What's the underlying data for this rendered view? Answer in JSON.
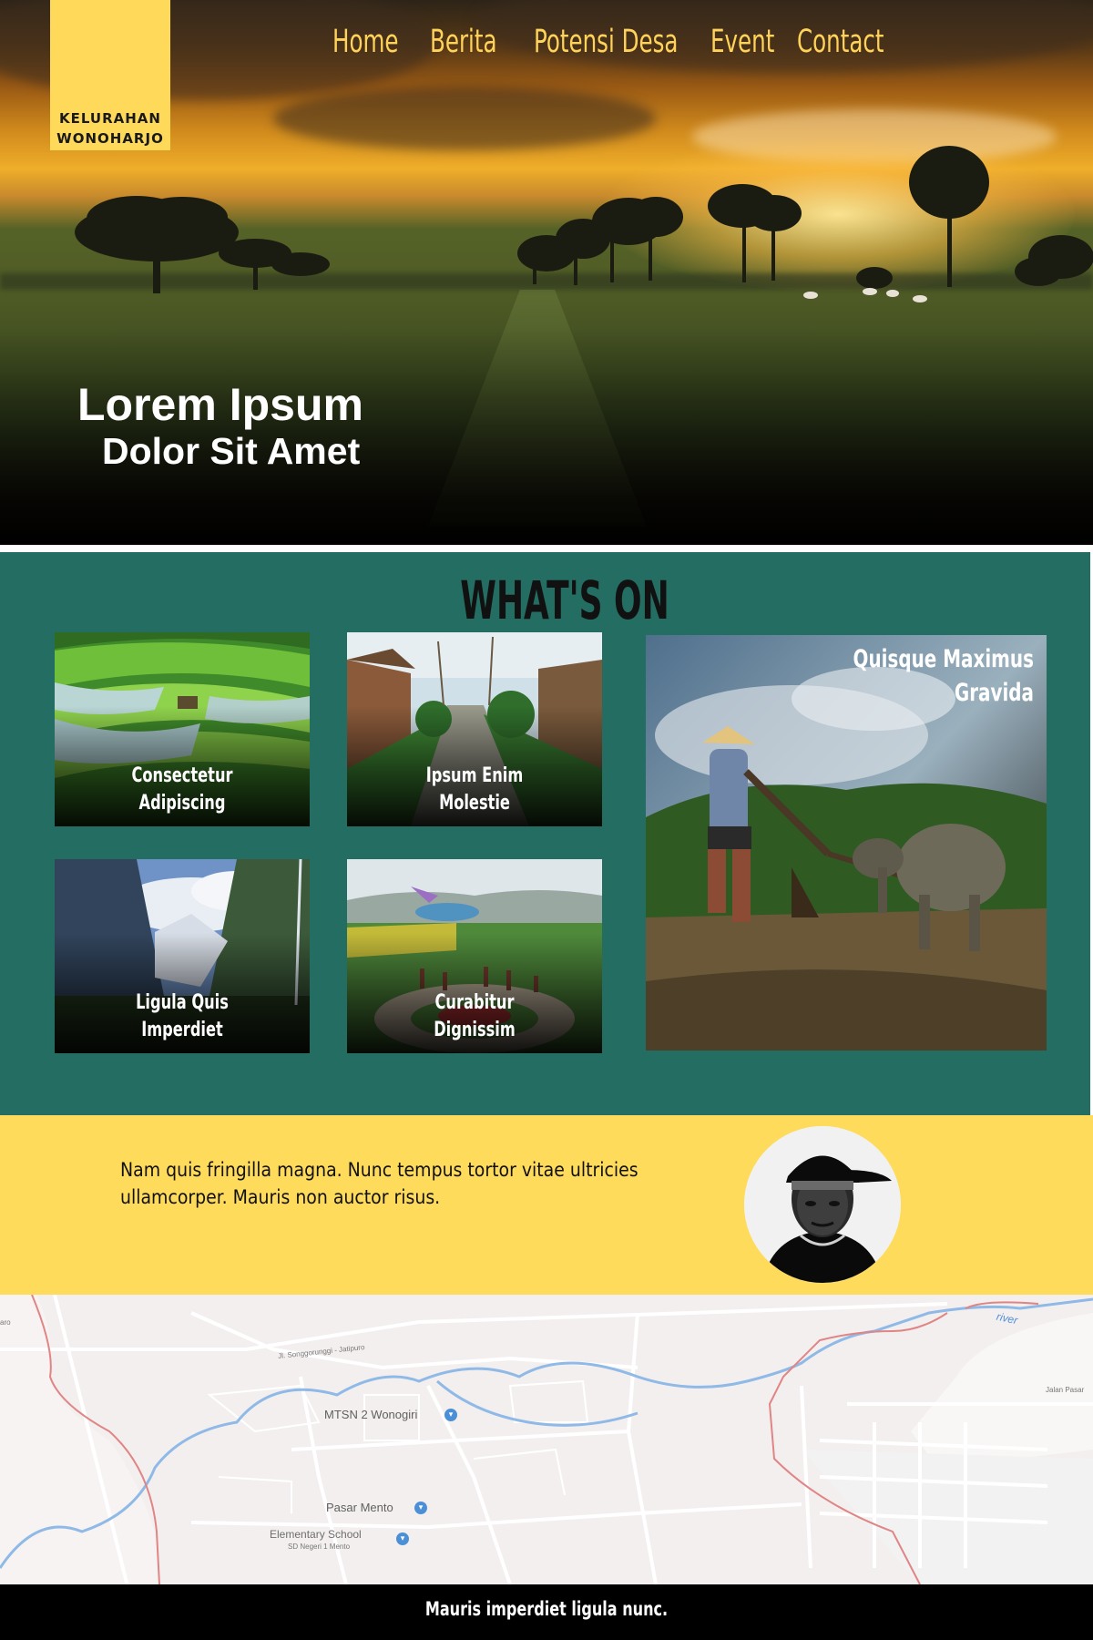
{
  "brand": {
    "line1": "KELURAHAN",
    "line2": "WONOHARJO",
    "color": "#ffd95a"
  },
  "nav": {
    "items": [
      "Home",
      "Berita",
      "Potensi Desa",
      "Event",
      "Contact"
    ],
    "color": "#ffd35a"
  },
  "hero": {
    "title": "Lorem Ipsum",
    "subtitle": "Dolor Sit Amet"
  },
  "whats_on": {
    "heading": "WHAT'S ON",
    "background": "#246d62",
    "cards": [
      {
        "line1": "Consectetur",
        "line2": "Adipiscing"
      },
      {
        "line1": "Ipsum Enim",
        "line2": "Molestie"
      },
      {
        "line1": "Ligula Quis",
        "line2": "Imperdiet"
      },
      {
        "line1": "Curabitur",
        "line2": "Dignissim"
      }
    ],
    "feature": {
      "line1": "Quisque Maximus",
      "line2": "Gravida"
    }
  },
  "quote": {
    "text": "Nam quis fringilla magna. Nunc tempus tortor vitae ultricies ullamcorper. Mauris non auctor risus.",
    "background": "#ffdb5c"
  },
  "map": {
    "labels": {
      "road_songgorunggi": "Jl. Songgorunggi - Jatipuro",
      "mtsn": "MTSN 2 Wonogiri",
      "pasar": "Pasar Mento",
      "school_1": "Elementary School",
      "school_2": "SD Negeri 1 Mento",
      "river": "river",
      "jalan_pasar": "Jalan Pasar",
      "edge_left": "aro"
    }
  },
  "footer": {
    "text": "Mauris imperdiet ligula nunc."
  }
}
